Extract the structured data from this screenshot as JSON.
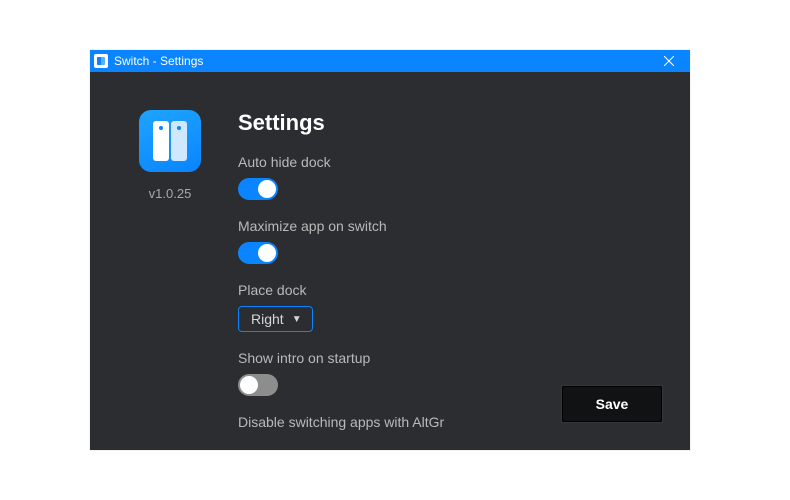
{
  "window": {
    "title": "Switch - Settings"
  },
  "sidebar": {
    "version": "v1.0.25"
  },
  "main": {
    "title": "Settings",
    "settings": {
      "auto_hide": {
        "label": "Auto hide dock",
        "value": true
      },
      "maximize": {
        "label": "Maximize app on switch",
        "value": true
      },
      "place_dock": {
        "label": "Place dock",
        "value": "Right"
      },
      "show_intro": {
        "label": "Show intro on startup",
        "value": false
      },
      "disable_altgr": {
        "label": "Disable switching apps with AltGr",
        "value": false
      }
    },
    "save_label": "Save"
  }
}
